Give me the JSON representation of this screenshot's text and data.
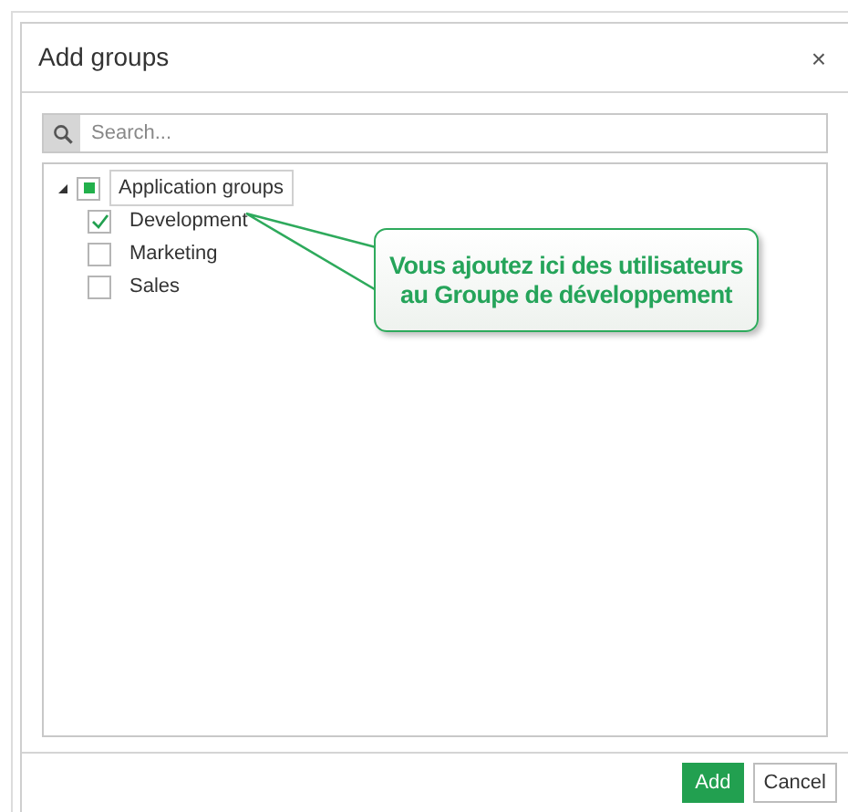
{
  "dialog": {
    "title": "Add groups",
    "close": "×"
  },
  "search": {
    "placeholder": "Search..."
  },
  "tree": [
    {
      "label": "Application groups",
      "expanded": true,
      "checked": false,
      "indeterminate": true,
      "selected": true,
      "children": [
        {
          "label": "Development",
          "checked": true,
          "indeterminate": false,
          "selected": false
        },
        {
          "label": "Marketing",
          "checked": false,
          "indeterminate": false,
          "selected": false
        },
        {
          "label": "Sales",
          "checked": false,
          "indeterminate": false,
          "selected": false
        }
      ]
    }
  ],
  "callout": {
    "lines": [
      "Vous ajoutez ici des utilisateurs",
      "au Groupe de développement"
    ]
  },
  "buttons": [
    {
      "label": "Add",
      "kind": "primary"
    },
    {
      "label": "Cancel",
      "kind": "secondary"
    }
  ]
}
